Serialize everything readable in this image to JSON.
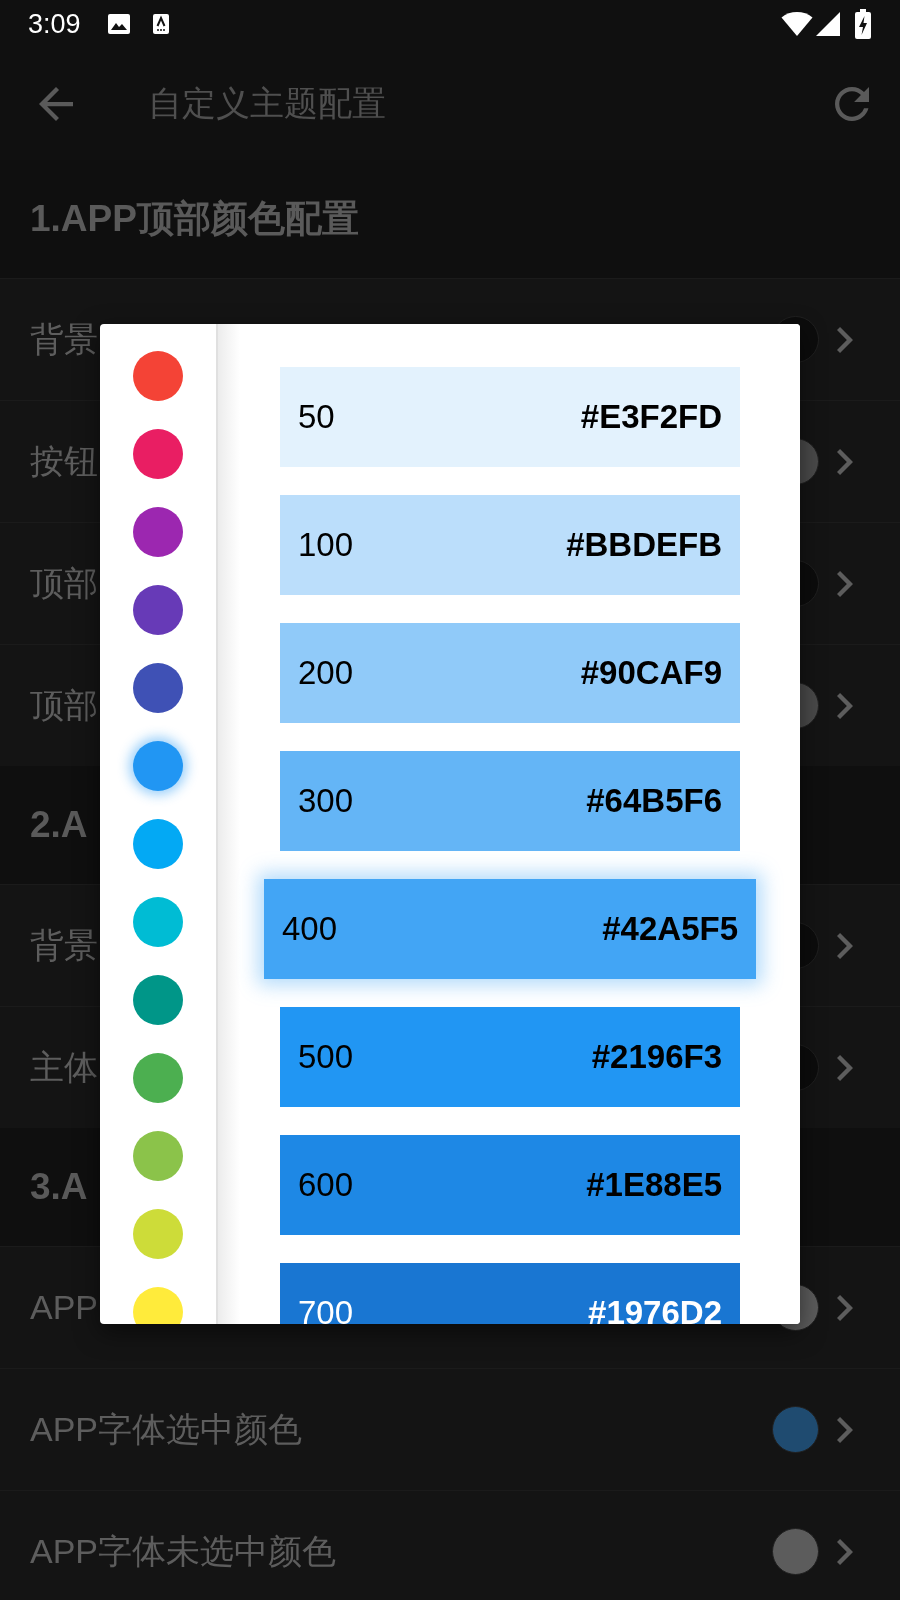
{
  "status_bar": {
    "time": "3:09"
  },
  "toolbar": {
    "title": "自定义主题配置"
  },
  "sections": [
    {
      "title": "1.APP顶部颜色配置",
      "rows": [
        {
          "label": "背景",
          "color": "#0c0c0c"
        },
        {
          "label": "按钮",
          "color": "#4a4a4a"
        },
        {
          "label": "顶部",
          "color": "#0c0c0c"
        },
        {
          "label": "顶部",
          "color": "#4a4a4a"
        }
      ]
    },
    {
      "title": "2.A",
      "rows": [
        {
          "label": "背景",
          "color": "#0c0c0c"
        },
        {
          "label": "主体",
          "color": "#0c0c0c"
        }
      ]
    },
    {
      "title": "3.A",
      "rows": [
        {
          "label": "APP",
          "color": "#5c5c5c"
        },
        {
          "label": "APP字体选中颜色",
          "color": "#1f4b70"
        },
        {
          "label": "APP字体未选中颜色",
          "color": "#5c5c5c"
        }
      ]
    }
  ],
  "color_dialog": {
    "palette": [
      {
        "color": "#f44336",
        "selected": false
      },
      {
        "color": "#e91e63",
        "selected": false
      },
      {
        "color": "#9c27b0",
        "selected": false
      },
      {
        "color": "#673ab7",
        "selected": false
      },
      {
        "color": "#3f51b5",
        "selected": false
      },
      {
        "color": "#2196f3",
        "selected": true
      },
      {
        "color": "#03a9f4",
        "selected": false
      },
      {
        "color": "#00bcd4",
        "selected": false
      },
      {
        "color": "#009688",
        "selected": false
      },
      {
        "color": "#4caf50",
        "selected": false
      },
      {
        "color": "#8bc34a",
        "selected": false
      },
      {
        "color": "#cddc39",
        "selected": false
      },
      {
        "color": "#ffeb3b",
        "selected": false
      }
    ],
    "shades": [
      {
        "shade": "50",
        "hex": "#E3F2FD",
        "color": "#e3f2fd",
        "selected": false
      },
      {
        "shade": "100",
        "hex": "#BBDEFB",
        "color": "#bbdefb",
        "selected": false
      },
      {
        "shade": "200",
        "hex": "#90CAF9",
        "color": "#90caf9",
        "selected": false
      },
      {
        "shade": "300",
        "hex": "#64B5F6",
        "color": "#64b5f6",
        "selected": false
      },
      {
        "shade": "400",
        "hex": "#42A5F5",
        "color": "#42a5f5",
        "selected": true
      },
      {
        "shade": "500",
        "hex": "#2196F3",
        "color": "#2196f3",
        "selected": false
      },
      {
        "shade": "600",
        "hex": "#1E88E5",
        "color": "#1e88e5",
        "selected": false
      },
      {
        "shade": "700",
        "hex": "#1976D2",
        "color": "#1976d2",
        "selected": false
      }
    ]
  }
}
